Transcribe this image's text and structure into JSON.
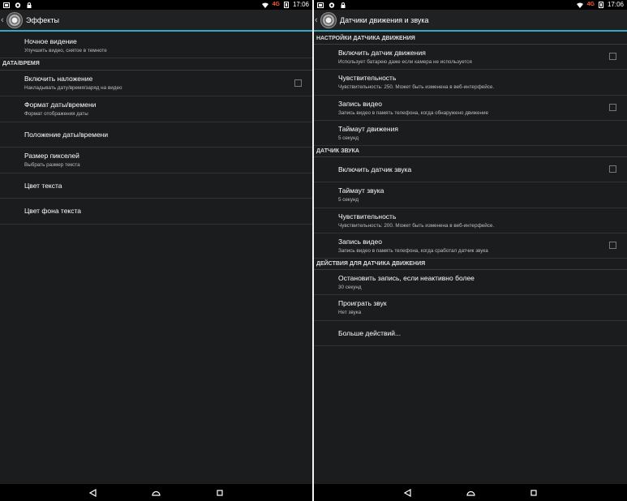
{
  "status": {
    "network": "4G",
    "time": "17:06"
  },
  "left": {
    "title": "Эффекты",
    "rows": [
      {
        "title": "Ночное видение",
        "summary": "Улучшить видео, снятое в темноте"
      }
    ],
    "section_datetime": "ДАТА/ВРЕМЯ",
    "datetime_rows": [
      {
        "title": "Включить наложение",
        "summary": "Накладывать дату/время/заряд на видео"
      },
      {
        "title": "Формат даты/времени",
        "summary": "Формат отображения даты"
      },
      {
        "title": "Положение даты/времени"
      },
      {
        "title": "Размер пикселей",
        "summary": "Выбрать размер текста"
      },
      {
        "title": "Цвет текста"
      },
      {
        "title": "Цвет фона текста"
      }
    ]
  },
  "right": {
    "title": "Датчики движения и звука",
    "section_motion": "НАСТРОЙКИ ДАТЧИКА ДВИЖЕНИЯ",
    "motion_rows": [
      {
        "title": "Включить датчик движения",
        "summary": "Использует батарею даже если камера не используется"
      },
      {
        "title": "Чувствительность",
        "summary": "Чувствительность: 250. Может быть изменена в веб-интерфейсе."
      },
      {
        "title": "Запись видео",
        "summary": "Запись видео в память телефона, когда обнаружено движение"
      },
      {
        "title": "Таймаут движения",
        "summary": "5 секунд"
      }
    ],
    "section_sound": "ДАТЧИК ЗВУКА",
    "sound_rows": [
      {
        "title": "Включить датчик звука"
      },
      {
        "title": "Таймаут звука",
        "summary": "5 секунд"
      },
      {
        "title": "Чувствительность",
        "summary": "Чувствительность: 200. Может быть изменена в веб-интерфейсе."
      },
      {
        "title": "Запись видео",
        "summary": "Запись видео в память телефона, когда сработал датчик звука"
      }
    ],
    "section_actions": "ДЕЙСТВИЯ ДЛЯ ДАТЧИКА ДВИЖЕНИЯ",
    "action_rows": [
      {
        "title": "Остановить запись, если неактивно более",
        "summary": "30 секунд"
      },
      {
        "title": "Проиграть звук",
        "summary": "Нет звука"
      },
      {
        "title": "Больше действий..."
      }
    ]
  }
}
